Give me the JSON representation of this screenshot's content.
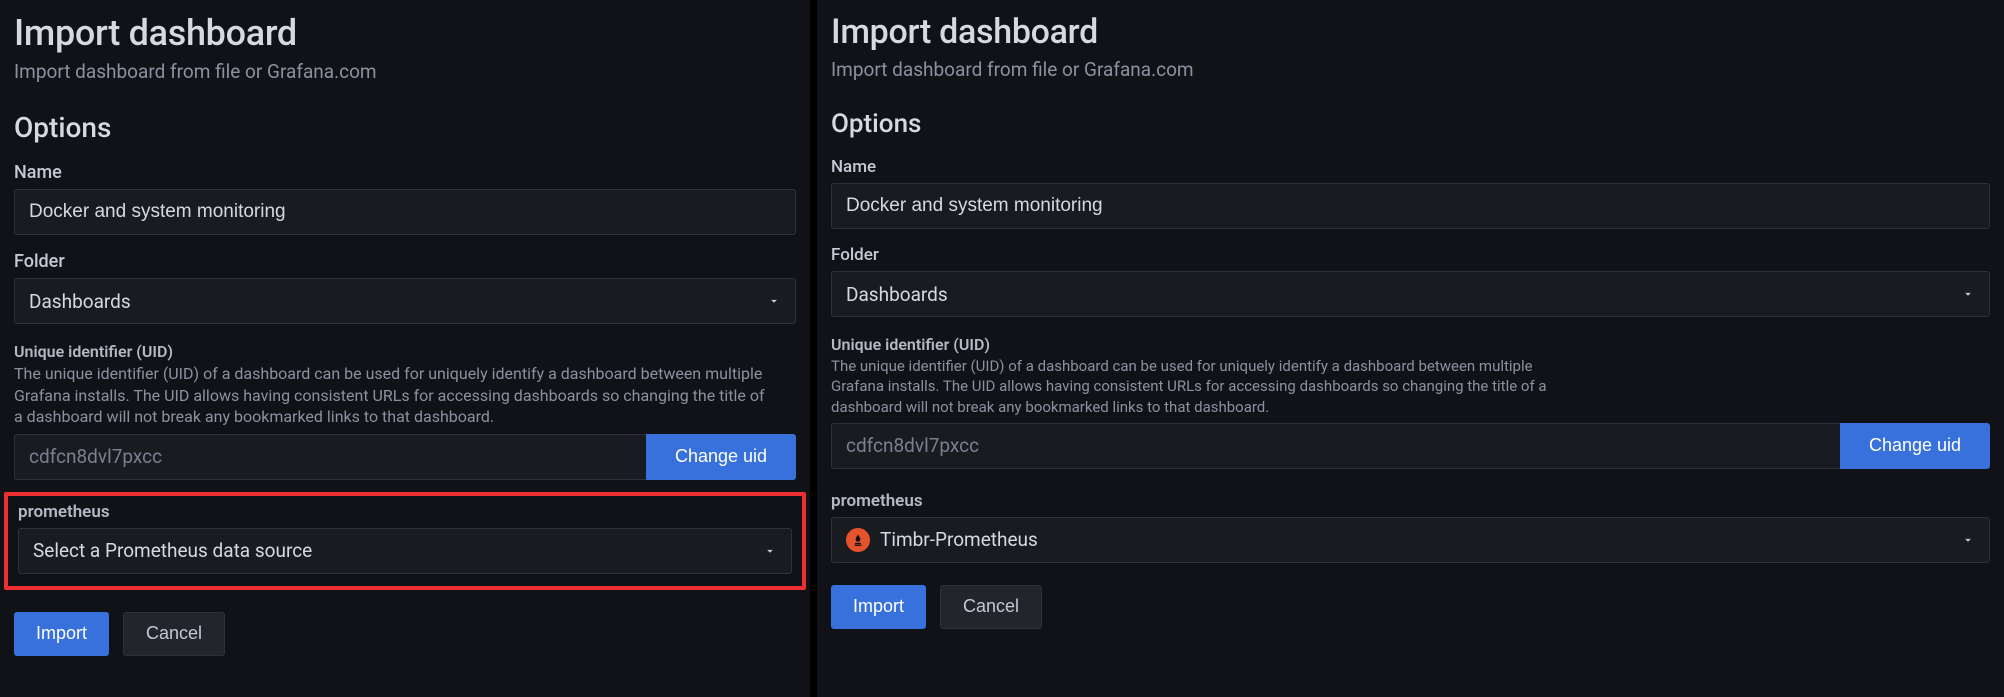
{
  "left": {
    "title": "Import dashboard",
    "subtitle": "Import dashboard from file or Grafana.com",
    "options_heading": "Options",
    "name_label": "Name",
    "name_value": "Docker and system monitoring",
    "folder_label": "Folder",
    "folder_value": "Dashboards",
    "uid_label": "Unique identifier (UID)",
    "uid_help": "The unique identifier (UID) of a dashboard can be used for uniquely identify a dashboard between multiple Grafana installs. The UID allows having consistent URLs for accessing dashboards so changing the title of a dashboard will not break any bookmarked links to that dashboard.",
    "uid_value": "cdfcn8dvl7pxcc",
    "uid_button": "Change uid",
    "datasource_label": "prometheus",
    "datasource_value": "Select a Prometheus data source",
    "import_button": "Import",
    "cancel_button": "Cancel"
  },
  "right": {
    "title": "Import dashboard",
    "subtitle": "Import dashboard from file or Grafana.com",
    "options_heading": "Options",
    "name_label": "Name",
    "name_value": "Docker and system monitoring",
    "folder_label": "Folder",
    "folder_value": "Dashboards",
    "uid_label": "Unique identifier (UID)",
    "uid_help": "The unique identifier (UID) of a dashboard can be used for uniquely identify a dashboard between multiple Grafana installs. The UID allows having consistent URLs for accessing dashboards so changing the title of a dashboard will not break any bookmarked links to that dashboard.",
    "uid_value": "cdfcn8dvl7pxcc",
    "uid_button": "Change uid",
    "datasource_label": "prometheus",
    "datasource_value": "Timbr-Prometheus",
    "import_button": "Import",
    "cancel_button": "Cancel"
  }
}
